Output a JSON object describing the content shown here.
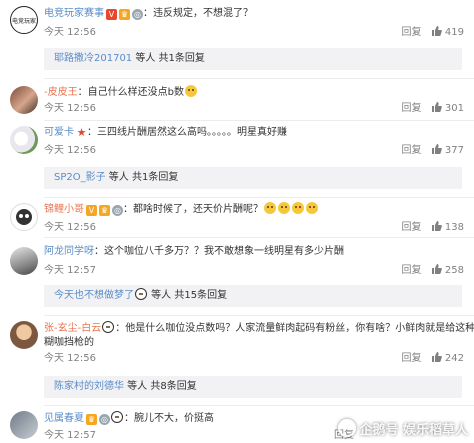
{
  "comments": [
    {
      "username": "电竞玩家赛事",
      "text": "：违反规定，不想混了？",
      "time": "今天 12:56",
      "reply_label": "回复",
      "likes": "419",
      "reply_preview": {
        "name": "耶路撒冷201701",
        "summary": " 等人 共1条回复"
      }
    },
    {
      "username": "-皮皮王",
      "text": "：自己什么样还没点b数",
      "time": "今天 12:56",
      "reply_label": "回复",
      "likes": "301"
    },
    {
      "username": "可爱卡",
      "text": "：三四线片酬居然这么高吗。。。。。明星真好赚",
      "time": "今天 12:56",
      "reply_label": "回复",
      "likes": "377",
      "reply_preview": {
        "name": "SP2O_影子",
        "summary": " 等人 共1条回复"
      }
    },
    {
      "username": "锦鲤小哥",
      "text": "：都啥时候了，还天价片酬呢？",
      "time": "今天 12:56",
      "reply_label": "回复",
      "likes": "138"
    },
    {
      "username": "阿龙同学呀",
      "text": "：这个咖位八千多万？？我不敢想象一线明星有多少片酬",
      "time": "今天 12:57",
      "reply_label": "回复",
      "likes": "258",
      "reply_preview": {
        "name": "今天也不想做梦了",
        "summary": " 等人 共15条回复"
      }
    },
    {
      "username": "张-玄尘-白云",
      "text": "：他是什么咖位没点数吗？人家流量鲜肉起码有粉丝，你有啥？小鲜肉就是给这种",
      "text2": "糊咖挡枪的",
      "time": "今天 12:56",
      "reply_label": "回复",
      "likes": "242",
      "reply_preview": {
        "name": "陈家村的刘德华",
        "summary": " 等人 共8条回复"
      }
    },
    {
      "username": "见属春夏",
      "text": "：腕儿不大，价挺高",
      "time": "今天 12:57",
      "reply_label": "回复"
    }
  ],
  "watermark": "企鹅号 娱乐稻草人",
  "colors": {
    "username": "#eb7350",
    "link": "#5a8cc8",
    "reply_bg": "#f2f2f5",
    "meta": "#808080"
  }
}
